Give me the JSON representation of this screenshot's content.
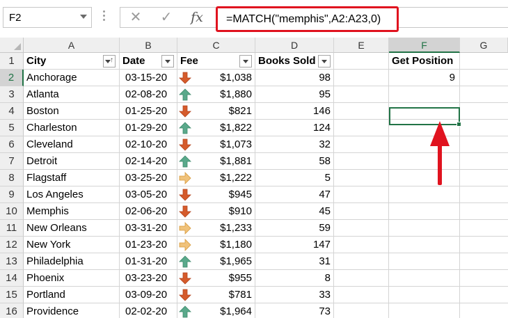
{
  "formula_bar": {
    "name_box": "F2",
    "cancel_icon": "✕",
    "enter_icon": "✓",
    "fx_label": "fx",
    "formula": "=MATCH(\"memphis\",A2:A23,0)"
  },
  "columns": [
    "A",
    "B",
    "C",
    "D",
    "E",
    "F",
    "G"
  ],
  "active_column": "F",
  "active_row": "2",
  "header_row": {
    "row_number": "1",
    "city": "City",
    "date": "Date",
    "fee": "Fee",
    "books_sold": "Books Sold",
    "get_position": "Get Position"
  },
  "rows": [
    {
      "n": "2",
      "city": "Anchorage",
      "date": "03-15-20",
      "trend": "down",
      "fee": "$1,038",
      "books": "98"
    },
    {
      "n": "3",
      "city": "Atlanta",
      "date": "02-08-20",
      "trend": "up",
      "fee": "$1,880",
      "books": "95"
    },
    {
      "n": "4",
      "city": "Boston",
      "date": "01-25-20",
      "trend": "down",
      "fee": "$821",
      "books": "146"
    },
    {
      "n": "5",
      "city": "Charleston",
      "date": "01-29-20",
      "trend": "up",
      "fee": "$1,822",
      "books": "124"
    },
    {
      "n": "6",
      "city": "Cleveland",
      "date": "02-10-20",
      "trend": "down",
      "fee": "$1,073",
      "books": "32"
    },
    {
      "n": "7",
      "city": "Detroit",
      "date": "02-14-20",
      "trend": "up",
      "fee": "$1,881",
      "books": "58"
    },
    {
      "n": "8",
      "city": "Flagstaff",
      "date": "03-25-20",
      "trend": "right",
      "fee": "$1,222",
      "books": "5"
    },
    {
      "n": "9",
      "city": "Los Angeles",
      "date": "03-05-20",
      "trend": "down",
      "fee": "$945",
      "books": "47"
    },
    {
      "n": "10",
      "city": "Memphis",
      "date": "02-06-20",
      "trend": "down",
      "fee": "$910",
      "books": "45"
    },
    {
      "n": "11",
      "city": "New Orleans",
      "date": "03-31-20",
      "trend": "right",
      "fee": "$1,233",
      "books": "59"
    },
    {
      "n": "12",
      "city": "New York",
      "date": "01-23-20",
      "trend": "right",
      "fee": "$1,180",
      "books": "147"
    },
    {
      "n": "13",
      "city": "Philadelphia",
      "date": "01-31-20",
      "trend": "up",
      "fee": "$1,965",
      "books": "31"
    },
    {
      "n": "14",
      "city": "Phoenix",
      "date": "03-23-20",
      "trend": "down",
      "fee": "$955",
      "books": "8"
    },
    {
      "n": "15",
      "city": "Portland",
      "date": "03-09-20",
      "trend": "down",
      "fee": "$781",
      "books": "33"
    },
    {
      "n": "16",
      "city": "Providence",
      "date": "02-02-20",
      "trend": "up",
      "fee": "$1,964",
      "books": "73"
    }
  ],
  "result": {
    "cell": "F2",
    "value": "9"
  },
  "colors": {
    "excel_green": "#217346",
    "highlight_red": "#e0131f",
    "arrow_up": "#5aa98b",
    "arrow_down": "#d55b2b",
    "arrow_right": "#f0c27a"
  },
  "icons": {
    "up": "green-up-arrow-icon",
    "down": "red-down-arrow-icon",
    "right": "yellow-right-arrow-icon"
  }
}
